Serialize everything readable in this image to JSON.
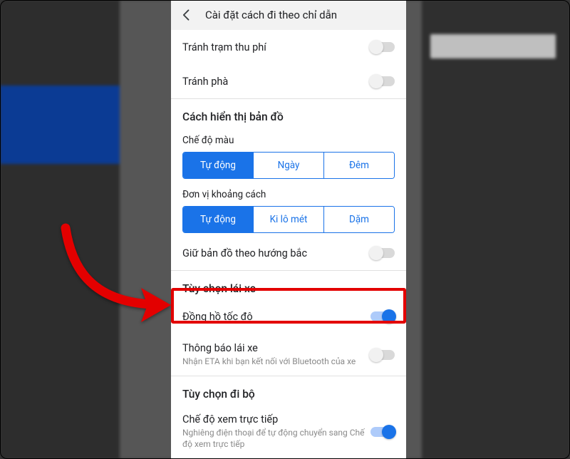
{
  "header": {
    "title": "Cài đặt cách đi theo chỉ dẫn"
  },
  "avoid": {
    "tolls": {
      "label": "Tránh trạm thu phí",
      "on": false
    },
    "ferries": {
      "label": "Tránh phà",
      "on": false
    }
  },
  "mapDisplay": {
    "title": "Cách hiển thị bản đồ",
    "colorMode": {
      "label": "Chế độ màu",
      "options": [
        "Tự động",
        "Ngày",
        "Đêm"
      ],
      "selected": 0
    },
    "distanceUnit": {
      "label": "Đơn vị khoảng cách",
      "options": [
        "Tự động",
        "Ki lô mét",
        "Dặm"
      ],
      "selected": 0
    },
    "keepNorthUp": {
      "label": "Giữ bản đồ theo hướng bắc",
      "on": false
    }
  },
  "driving": {
    "title": "Tùy chọn lái xe",
    "speedometer": {
      "label": "Đồng hồ tốc độ",
      "on": true
    },
    "notif": {
      "label": "Thông báo lái xe",
      "sub": "Nhận ETA khi bạn kết nối với Bluetooth của xe",
      "on": false
    }
  },
  "walking": {
    "title": "Tùy chọn đi bộ",
    "liveView": {
      "label": "Chế độ xem trực tiếp",
      "sub": "Nghiêng điện thoại để tự động chuyển sang Chế độ xem trực tiếp",
      "on": true
    }
  },
  "colors": {
    "accent": "#1a73e8",
    "highlight": "#e30000"
  }
}
